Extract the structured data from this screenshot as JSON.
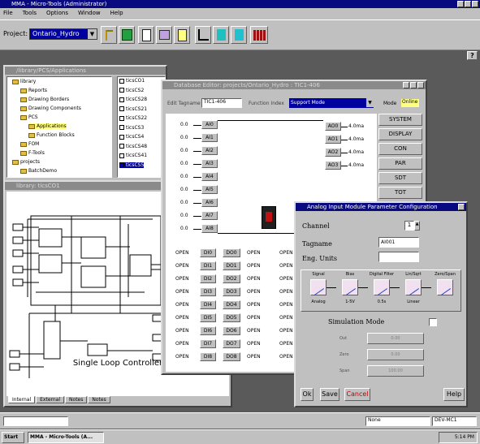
{
  "app": {
    "title": "MMA - Micro-Tools (Administrator)",
    "menu": [
      "File",
      "Tools",
      "Options",
      "Window",
      "Help"
    ],
    "project_label": "Project:",
    "project_value": "Ontario_Hydro",
    "help_char": "?"
  },
  "tree_window": {
    "title": "/library/PCS/Applications",
    "items": [
      "library",
      "Reports",
      "Drawing Borders",
      "Drawing Components",
      "PCS",
      "Applications",
      "Function Blocks",
      "FOM",
      "F-Tools",
      "projects",
      "BatchDemo"
    ],
    "list": [
      "ticsCO1",
      "ticsCS2",
      "ticsCS28",
      "ticsCS21",
      "ticsCS22",
      "ticsCS3",
      "ticsCS4",
      "ticsCS48",
      "ticsCS41",
      "ticsCS5"
    ]
  },
  "loop_window": {
    "title": "library: ticsCO1",
    "caption": "Single Loop Controller",
    "tabs": [
      "Internal",
      "External",
      "Notes",
      "Notes"
    ]
  },
  "db_editor": {
    "title": "Database Editor: projects/Ontario_Hydro : TIC1-406",
    "edit_tagname_label": "Edit Tagname",
    "edit_tagname_value": "TIC1-406",
    "function_index_label": "Function Index",
    "function_index_value": "Support Mode",
    "mode_label": "Mode",
    "mode_value": "Online",
    "analog_inputs": [
      "AI0",
      "AI1",
      "AI2",
      "AI3",
      "AI4",
      "AI5",
      "AI6",
      "AI7",
      "AI8"
    ],
    "analog_outputs": [
      "AO0",
      "AO1",
      "AO2",
      "AO3"
    ],
    "ao_value": "4.0ma",
    "ai_value": "0.0",
    "di_left": [
      "DI0",
      "DI1",
      "DI2",
      "DI3",
      "DI4",
      "DI5",
      "DI6",
      "DI7",
      "DI8"
    ],
    "di_right": [
      "DO0",
      "DO1",
      "DO2",
      "DO3",
      "DO4",
      "DO5",
      "DO6",
      "DO7",
      "DO8"
    ],
    "open_label": "OPEN",
    "side_buttons": [
      "SYSTEM",
      "DISPLAY",
      "CON",
      "PAR",
      "SDT",
      "TOT"
    ]
  },
  "ai_dialog": {
    "title": "Analog Input Module Parameter Configuration",
    "channel_label": "Channel",
    "channel_value": "1",
    "tagname_label": "Tagname",
    "tagname_value": "AI001",
    "eng_units_label": "Eng. Units",
    "eng_units_value": "",
    "stages": [
      {
        "label": "Signal",
        "sub": "Analog"
      },
      {
        "label": "Bias",
        "sub": "1-5V"
      },
      {
        "label": "Digital Filter",
        "sub": "0.5s"
      },
      {
        "label": "Lin/Sqrt",
        "sub": "Linear"
      },
      {
        "label": "Zero/Span",
        "sub": ""
      }
    ],
    "sim_label": "Simulation Mode",
    "sim_fields": [
      {
        "label": "Out",
        "value": "0.00"
      },
      {
        "label": "Zero",
        "value": "0.00"
      },
      {
        "label": "Span",
        "value": "100.00"
      }
    ],
    "buttons": {
      "ok": "Ok",
      "save": "Save",
      "cancel": "Cancel",
      "help": "Help"
    }
  },
  "statusbar": {
    "left": "",
    "mid": "None",
    "right": "DEV-MC1"
  },
  "taskbar": {
    "start": "Start",
    "task": "MMA - Micro-Tools (A...",
    "clock": "5:14 PM"
  }
}
